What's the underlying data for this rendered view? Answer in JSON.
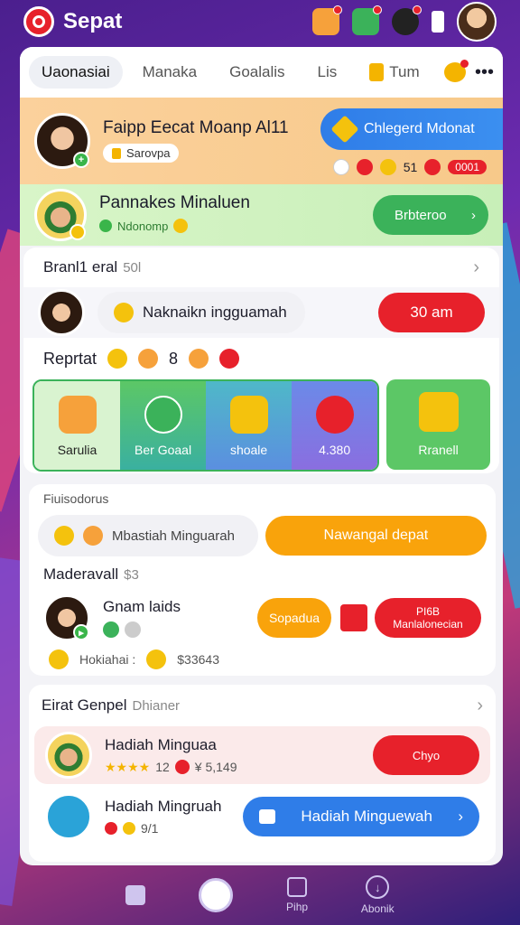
{
  "app": {
    "name": "Sepat"
  },
  "tabs": [
    {
      "label": "Uaonasiai"
    },
    {
      "label": "Manaka"
    },
    {
      "label": "Goalalis"
    },
    {
      "label": "Lis"
    },
    {
      "label": "Tum"
    }
  ],
  "more_label": "•••",
  "profile": {
    "name": "Faipp Eecat Moanp Al11",
    "chip": "Sarovpa",
    "cta": "Chlegerd Mdonat",
    "stat_value": "51",
    "stat_badge": "0001"
  },
  "promo": {
    "name": "Pannakes Minaluen",
    "chip": "Ndonomp",
    "button": "Brbteroo"
  },
  "section1": {
    "title": "Branl1 eral",
    "sub": "50l",
    "item_label": "Naknaikn ingguamah",
    "item_button": "30 am"
  },
  "reward": {
    "title": "Reprtat",
    "count": "8",
    "tiles": [
      {
        "label": "Sarulia"
      },
      {
        "label": "Ber Goaal"
      },
      {
        "label": "shoale"
      },
      {
        "label": "4.380"
      }
    ],
    "last_tile": "Rranell"
  },
  "section2": {
    "title": "Fiuisodorus",
    "row_label": "Mbastiah Minguarah",
    "row_button": "Nawangal depat",
    "sub_title": "Maderavall",
    "sub_value": "$3",
    "user_name": "Gnam laids",
    "btn_orange": "Sopadua",
    "btn_red_top": "PI6B",
    "btn_red_bottom": "Manlalonecian",
    "points_label": "Hokiahai :",
    "points_value": "$33643"
  },
  "section3": {
    "title": "Eirat Genpel",
    "sub": "Dhianer",
    "items": [
      {
        "name": "Hadiah Minguaa",
        "meta": "12",
        "price": "¥ 5,149",
        "button": "Chyo"
      },
      {
        "name": "Hadiah Mingruah",
        "meta": "9/1",
        "button": "Hadiah Minguewah"
      }
    ]
  },
  "nav": [
    {
      "label": ""
    },
    {
      "label": ""
    },
    {
      "label": "Pihp"
    },
    {
      "label": "Abonik"
    }
  ],
  "colors": {
    "accent_red": "#e7212b",
    "accent_blue": "#2f7de8",
    "accent_green": "#3bb25a",
    "accent_orange": "#f9a30b"
  }
}
